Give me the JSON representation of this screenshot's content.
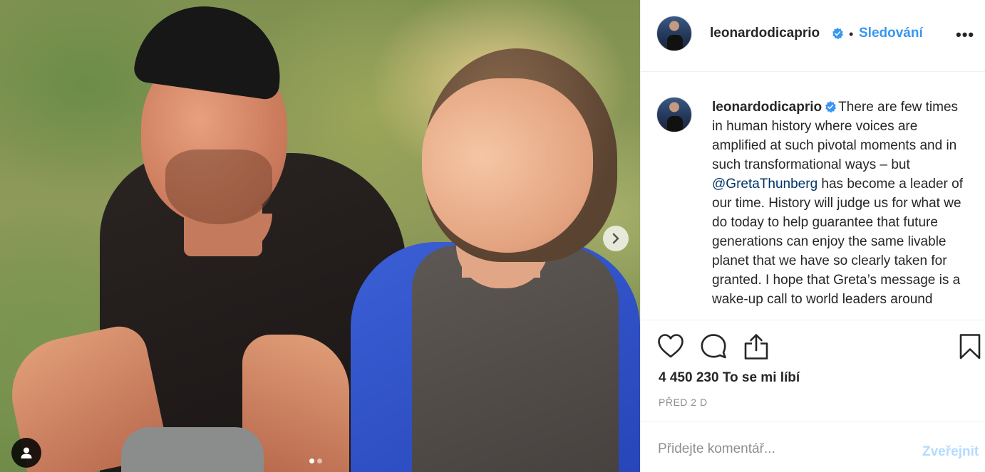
{
  "post": {
    "username": "leonardodicaprio",
    "verified": true,
    "separator": "•",
    "follow_label": "Sledování",
    "more_label": "•••",
    "caption": {
      "username": "leonardodicaprio",
      "text_before_mention": "There are few times in human history where voices are amplified at such pivotal moments and in such transformational ways – but ",
      "mention": "@GretaThunberg",
      "text_after_mention": " has become a leader of our time. History will judge us for what we do today to help guarantee that future generations can enjoy the same livable planet that we have so clearly taken for granted. I hope that Greta’s message is a wake-up call to world leaders around"
    },
    "likes": "4 450 230 To se mi líbí",
    "time": "PŘED 2 D",
    "comment_placeholder": "Přidejte komentář...",
    "publish_label": "Zveřejnit"
  },
  "photo": {
    "carousel_count": 2,
    "carousel_active": 1
  },
  "icons": {
    "like": "heart-icon",
    "comment": "comment-icon",
    "share": "share-icon",
    "save": "bookmark-icon",
    "next": "chevron-right-icon",
    "tag": "user-tag-icon",
    "verified": "verified-badge-icon"
  },
  "colors": {
    "link_blue": "#3897f0",
    "mention": "#003569",
    "publish_disabled": "#b3dbff",
    "muted": "#8e8e8e"
  }
}
